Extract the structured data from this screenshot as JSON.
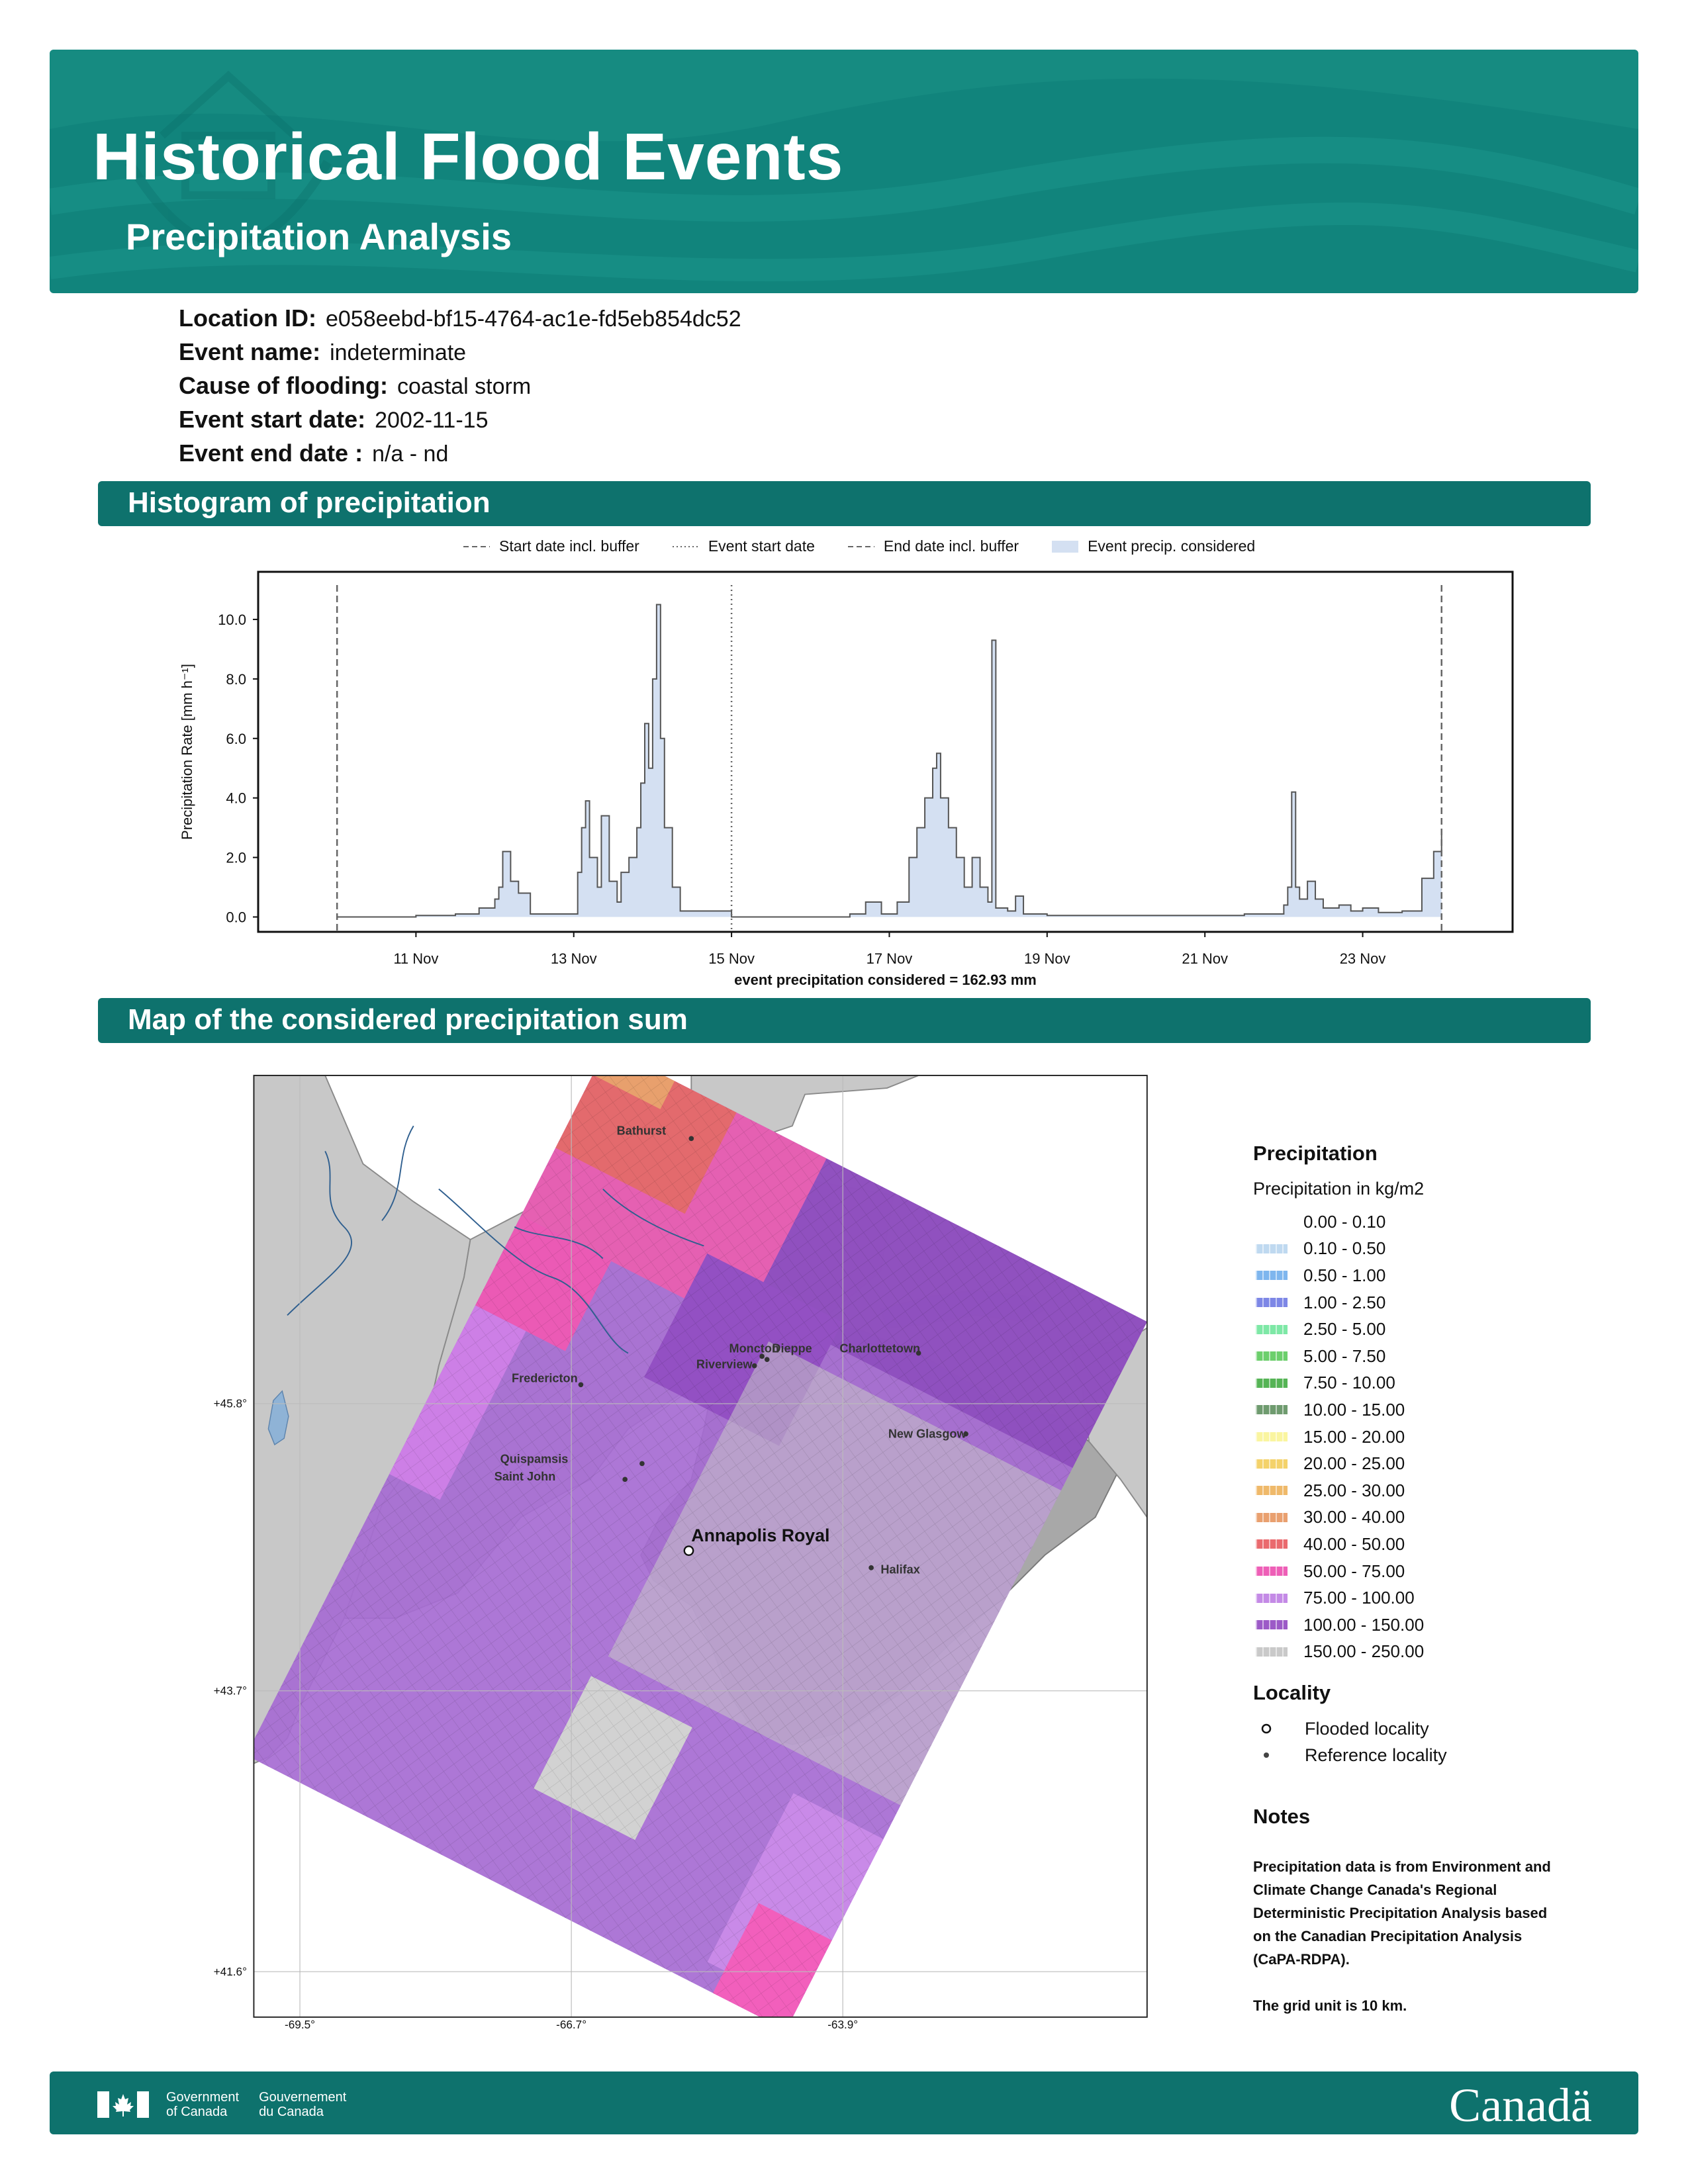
{
  "header": {
    "title": "Historical Flood Events",
    "subtitle": "Precipitation Analysis"
  },
  "event": {
    "location_id_label": "Location ID:",
    "location_id": "e058eebd-bf15-4764-ac1e-fd5eb854dc52",
    "event_name_label": "Event name:",
    "event_name": "indeterminate",
    "cause_label": "Cause of flooding:",
    "cause": "coastal storm",
    "start_label": "Event start date:",
    "start": "2002-11-15",
    "end_label": "Event end date :",
    "end": "n/a - nd"
  },
  "sections": {
    "histogram": "Histogram of precipitation",
    "map": "Map of the considered precipitation sum"
  },
  "chart_data": {
    "type": "area",
    "ylabel": "Precipitation Rate [mm h⁻¹]",
    "xlabel": "event precipitation considered = 162.93 mm",
    "ylim": [
      -0.5,
      11.6
    ],
    "yticks": [
      "0.0",
      "2.0",
      "4.0",
      "6.0",
      "8.0",
      "10.0"
    ],
    "xticks": [
      "11 Nov",
      "13 Nov",
      "15 Nov",
      "17 Nov",
      "19 Nov",
      "21 Nov",
      "23 Nov"
    ],
    "xlim_days": [
      9,
      24.9
    ],
    "legend": [
      "Start date incl. buffer",
      "Event start date",
      "End date incl. buffer",
      "Event precip. considered"
    ],
    "start_buffer_day": 10,
    "event_start_day": 15,
    "end_buffer_day": 24,
    "series": [
      {
        "values": [
          [
            10.0,
            0.0
          ],
          [
            11.0,
            0.05
          ],
          [
            11.5,
            0.1
          ],
          [
            11.8,
            0.3
          ],
          [
            12.0,
            0.6
          ],
          [
            12.05,
            1.0
          ],
          [
            12.1,
            2.2
          ],
          [
            12.2,
            1.2
          ],
          [
            12.3,
            0.8
          ],
          [
            12.45,
            0.1
          ],
          [
            13.0,
            0.1
          ],
          [
            13.05,
            1.5
          ],
          [
            13.1,
            3.0
          ],
          [
            13.15,
            3.9
          ],
          [
            13.2,
            2.0
          ],
          [
            13.3,
            1.0
          ],
          [
            13.35,
            3.4
          ],
          [
            13.45,
            1.2
          ],
          [
            13.55,
            0.5
          ],
          [
            13.6,
            1.5
          ],
          [
            13.7,
            2.0
          ],
          [
            13.8,
            3.0
          ],
          [
            13.85,
            4.5
          ],
          [
            13.9,
            6.5
          ],
          [
            13.95,
            5.0
          ],
          [
            14.0,
            8.0
          ],
          [
            14.05,
            10.5
          ],
          [
            14.1,
            6.0
          ],
          [
            14.15,
            3.0
          ],
          [
            14.25,
            1.0
          ],
          [
            14.35,
            0.2
          ],
          [
            15.0,
            0.0
          ],
          [
            16.5,
            0.1
          ],
          [
            16.7,
            0.5
          ],
          [
            16.9,
            0.1
          ],
          [
            17.1,
            0.5
          ],
          [
            17.25,
            2.0
          ],
          [
            17.35,
            3.0
          ],
          [
            17.45,
            4.0
          ],
          [
            17.55,
            5.0
          ],
          [
            17.6,
            5.5
          ],
          [
            17.65,
            4.0
          ],
          [
            17.75,
            3.0
          ],
          [
            17.85,
            2.0
          ],
          [
            17.95,
            1.0
          ],
          [
            18.05,
            2.0
          ],
          [
            18.15,
            1.0
          ],
          [
            18.25,
            0.5
          ],
          [
            18.3,
            9.3
          ],
          [
            18.35,
            0.3
          ],
          [
            18.5,
            0.2
          ],
          [
            18.6,
            0.7
          ],
          [
            18.7,
            0.1
          ],
          [
            19.0,
            0.05
          ],
          [
            21.0,
            0.05
          ],
          [
            21.5,
            0.1
          ],
          [
            21.9,
            0.1
          ],
          [
            22.0,
            0.4
          ],
          [
            22.05,
            1.0
          ],
          [
            22.1,
            4.2
          ],
          [
            22.15,
            1.0
          ],
          [
            22.2,
            0.6
          ],
          [
            22.3,
            1.2
          ],
          [
            22.4,
            0.6
          ],
          [
            22.5,
            0.3
          ],
          [
            22.7,
            0.4
          ],
          [
            22.85,
            0.2
          ],
          [
            23.0,
            0.3
          ],
          [
            23.2,
            0.15
          ],
          [
            23.5,
            0.2
          ],
          [
            23.75,
            1.3
          ],
          [
            23.9,
            2.2
          ],
          [
            24.0,
            2.8
          ]
        ]
      }
    ]
  },
  "map": {
    "lat_labels": [
      "+45.8°",
      "+43.7°",
      "+41.6°"
    ],
    "lon_labels": [
      "-69.5°",
      "-66.7°",
      "-63.9°"
    ],
    "cities": [
      "Bathurst",
      "Moncton",
      "Dieppe",
      "Charlottetown",
      "Riverview",
      "Fredericton",
      "New Glasgow",
      "Quispamsis",
      "Saint John",
      "Halifax"
    ],
    "flooded_locality": "Annapolis Royal"
  },
  "legend": {
    "title": "Precipitation",
    "subtitle": "Precipitation in kg/m2",
    "classes": [
      {
        "label": "0.00 - 0.10",
        "color": "#ffffff"
      },
      {
        "label": "0.10 - 0.50",
        "color": "#bfd9f0"
      },
      {
        "label": "0.50 - 1.00",
        "color": "#7eb6ee"
      },
      {
        "label": "1.00 - 2.50",
        "color": "#7d87e6"
      },
      {
        "label": "2.50 - 5.00",
        "color": "#7ee8a6"
      },
      {
        "label": "5.00 - 7.50",
        "color": "#6ccf6c"
      },
      {
        "label": "7.50 - 10.00",
        "color": "#55b455"
      },
      {
        "label": "10.00 - 15.00",
        "color": "#6f9b6f"
      },
      {
        "label": "15.00 - 20.00",
        "color": "#faf5a0"
      },
      {
        "label": "20.00 - 25.00",
        "color": "#f4d26a"
      },
      {
        "label": "25.00 - 30.00",
        "color": "#efb96a"
      },
      {
        "label": "30.00 - 40.00",
        "color": "#e9a06f"
      },
      {
        "label": "40.00 - 50.00",
        "color": "#ea6a6e"
      },
      {
        "label": "50.00 - 75.00",
        "color": "#ee5fb7"
      },
      {
        "label": "75.00 - 100.00",
        "color": "#c48ae6"
      },
      {
        "label": "100.00 - 150.00",
        "color": "#9c5ac7"
      },
      {
        "label": "150.00 - 250.00",
        "color": "#c9c9c9"
      }
    ],
    "locality_title": "Locality",
    "flooded_label": "Flooded locality",
    "reference_label": "Reference locality"
  },
  "notes": {
    "title": "Notes",
    "lines": [
      "Precipitation data is from Environment and",
      "Climate Change Canada's Regional",
      "Deterministic Precipitation Analysis based",
      "on the Canadian Precipitation Analysis",
      "(CaPA-RDPA)."
    ],
    "grid": "The grid unit is 10 km."
  },
  "footer": {
    "gov_en_1": "Government",
    "gov_en_2": "of Canada",
    "gov_fr_1": "Gouvernement",
    "gov_fr_2": "du Canada",
    "wordmark": "Canadä"
  }
}
